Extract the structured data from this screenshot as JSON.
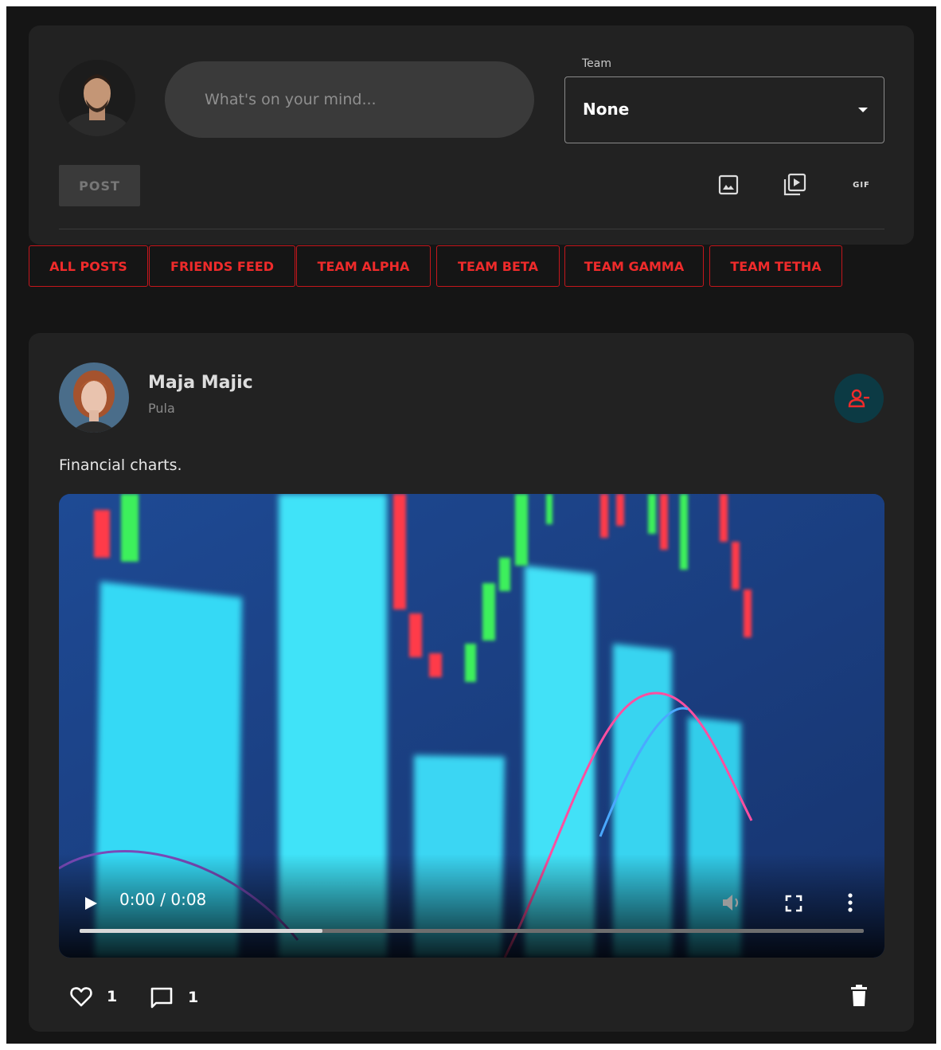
{
  "composer": {
    "avatar": "user-avatar",
    "placeholder": "What's on your mind...",
    "team_label": "Team",
    "team_value": "None",
    "post_label": "POST",
    "tools": [
      "image-icon",
      "video-library-icon",
      "gif-icon"
    ],
    "gif_label": "GIF"
  },
  "tabs": [
    "ALL POSTS",
    "FRIENDS FEED",
    "TEAM ALPHA",
    "TEAM BETA",
    "TEAM GAMMA",
    "TEAM TETHA"
  ],
  "post": {
    "author": "Maja Majic",
    "location": "Pula",
    "text": "Financial charts.",
    "video": {
      "time": "0:00 / 0:08",
      "progress_buffered": 0.31
    },
    "likes": "1",
    "comments": "1"
  },
  "colors": {
    "accent_red": "#ef2b2b",
    "card": "#222222",
    "background": "#151515"
  }
}
